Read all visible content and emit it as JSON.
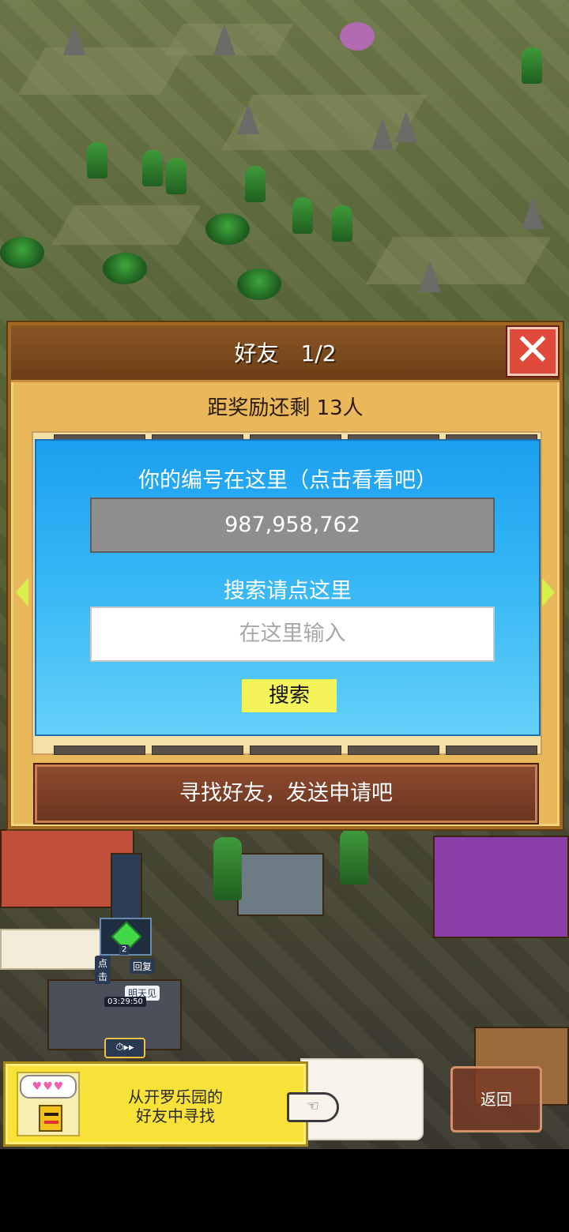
{
  "dialog": {
    "title": "好友　1/2",
    "close_symbol": "✕",
    "reward_text": "距奖励还剩 13人",
    "id_caption": "你的编号在这里（点击看看吧）",
    "player_id": "987,958,762",
    "search_caption": "搜索请点这里",
    "search_placeholder": "在这里输入",
    "search_button": "搜索",
    "find_friends_button": "寻找好友，发送申请吧"
  },
  "hud": {
    "badge_level": "2",
    "recover_label": "回复",
    "tomorrow_label": "明天见",
    "click_label": "点击",
    "timer_label": "03:29:50"
  },
  "bottom_bar": {
    "helper_text_line1": "从开罗乐园的",
    "helper_text_line2": "好友中寻找",
    "hearts": "♥♥♥",
    "back_button": "返回"
  },
  "colors": {
    "panel_blue": "#3cbaf6",
    "search_button_yellow": "#f4f45a",
    "close_red": "#e04a3a",
    "dialog_gold": "#e9b85a"
  }
}
